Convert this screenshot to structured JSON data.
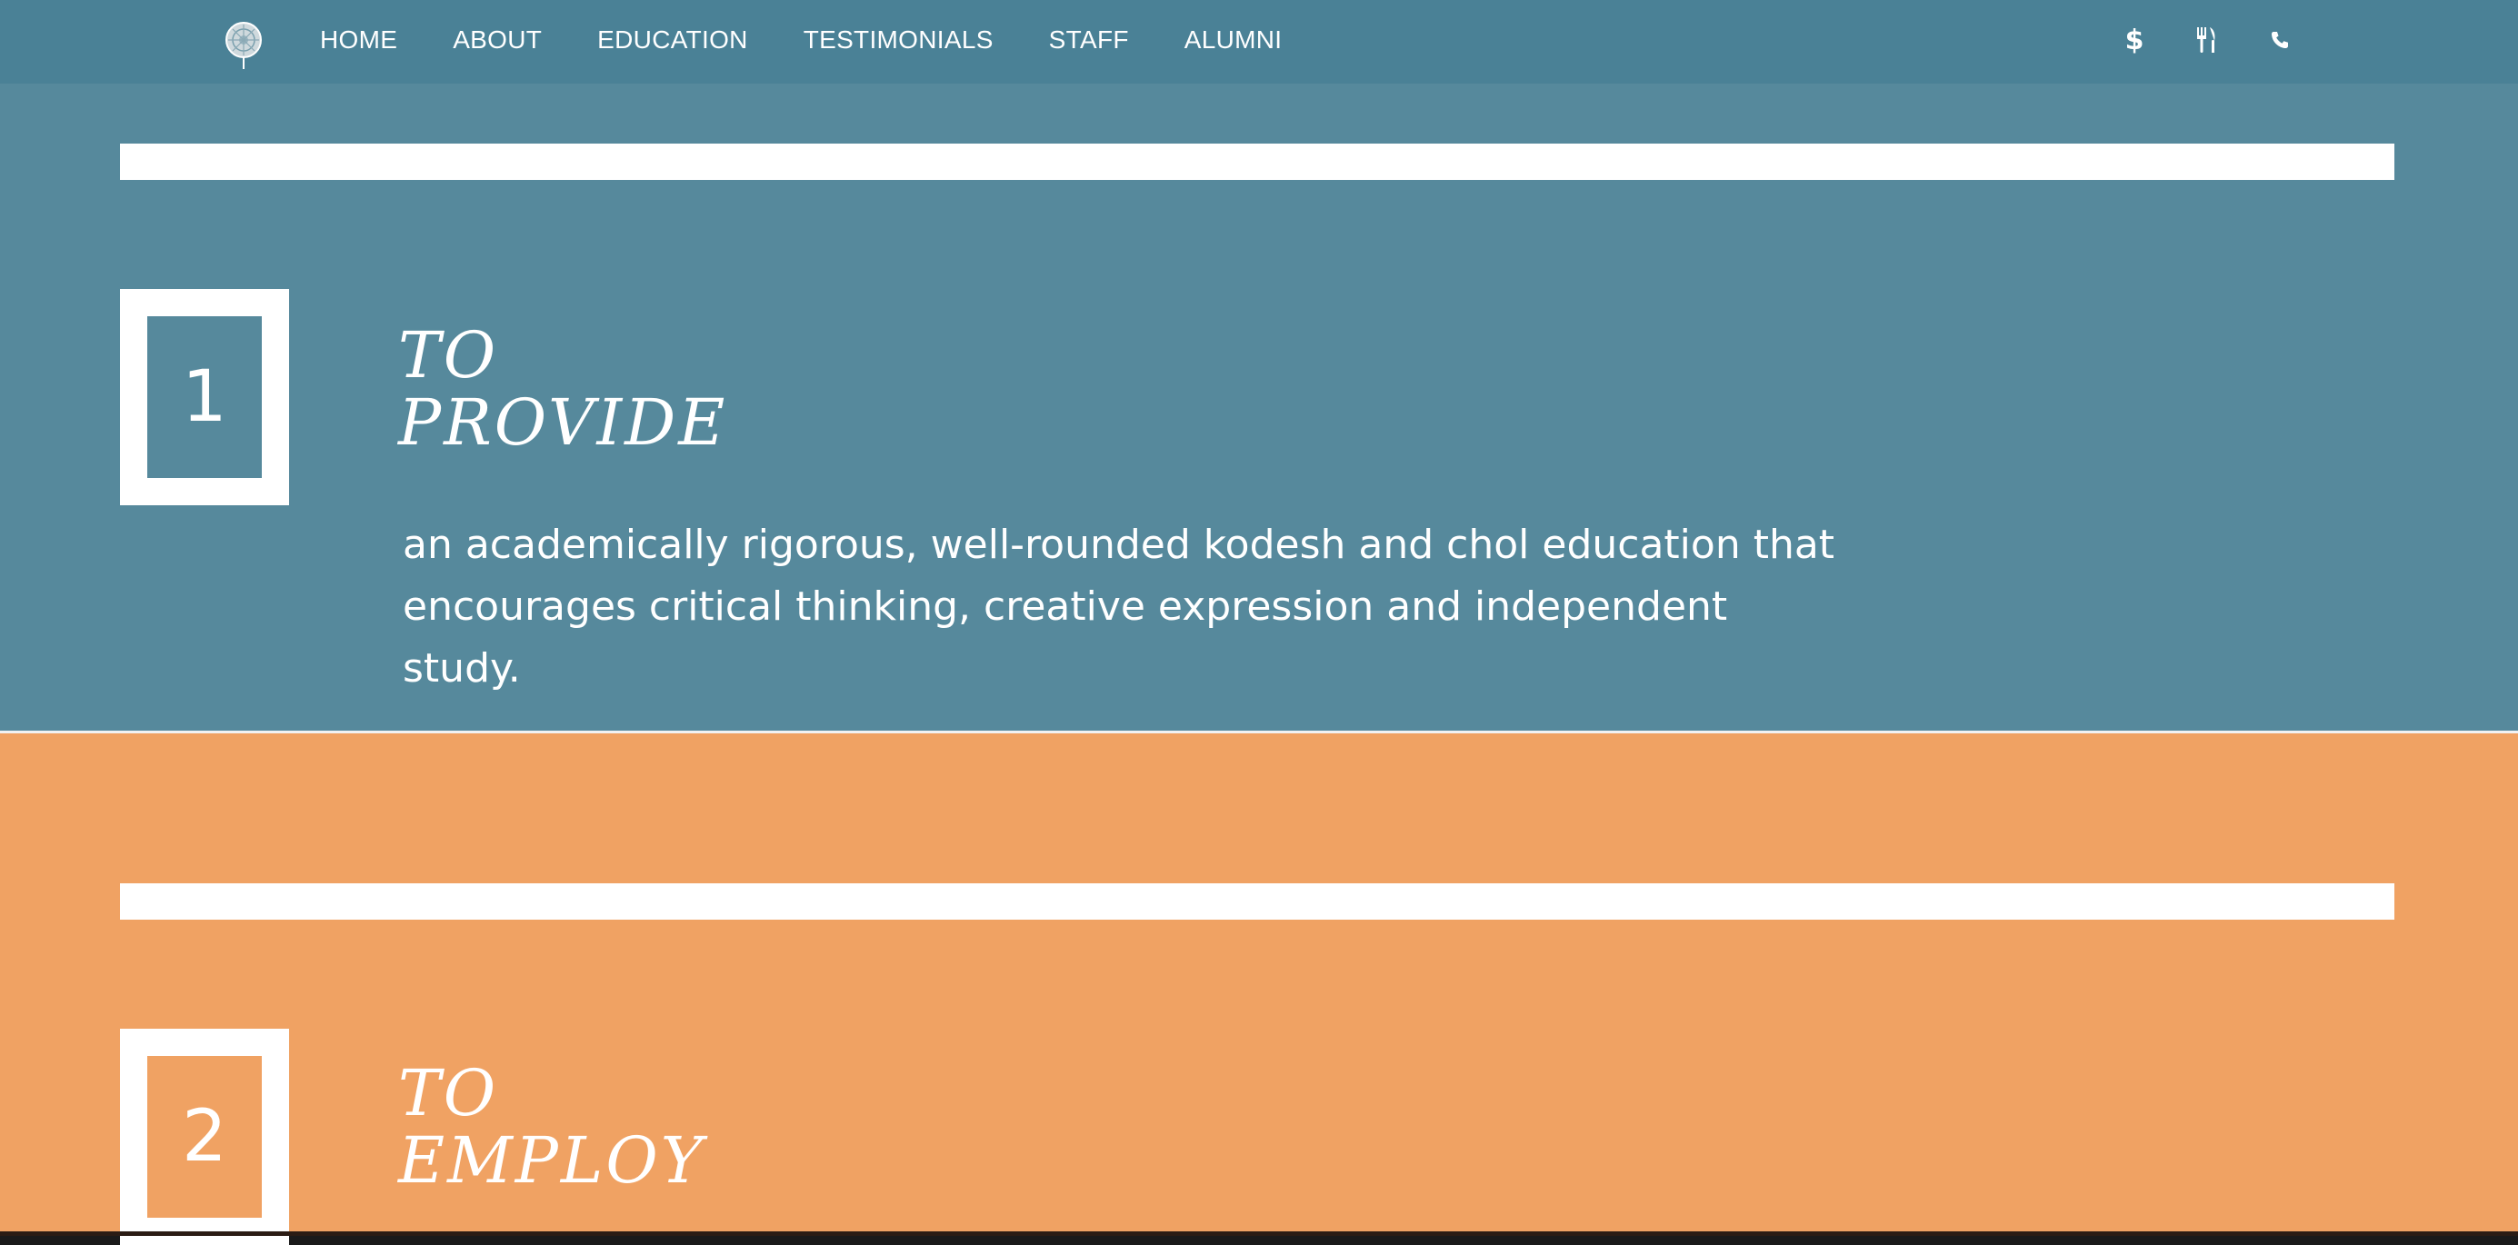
{
  "nav": {
    "logo_icon": "school-emblem-icon",
    "links": [
      "HOME",
      "ABOUT",
      "EDUCATION",
      "TESTIMONIALS",
      "STAFF",
      "ALUMNI"
    ],
    "icons": {
      "dollar": "$",
      "dining": "fork-knife-icon",
      "phone": "phone-icon"
    }
  },
  "colors": {
    "nav_bg": "#4a8196",
    "blue_section": "#56899c",
    "orange_section": "#f0a263",
    "white": "#ffffff"
  },
  "sections": [
    {
      "number": "1",
      "heading_line1": "TO",
      "heading_line2": "PROVIDE",
      "description": "an academically rigorous, well-rounded kodesh and chol education that encourages critical thinking, creative expression and independent study."
    },
    {
      "number": "2",
      "heading_line1": "TO",
      "heading_line2": "EMPLOY",
      "description": ""
    }
  ]
}
